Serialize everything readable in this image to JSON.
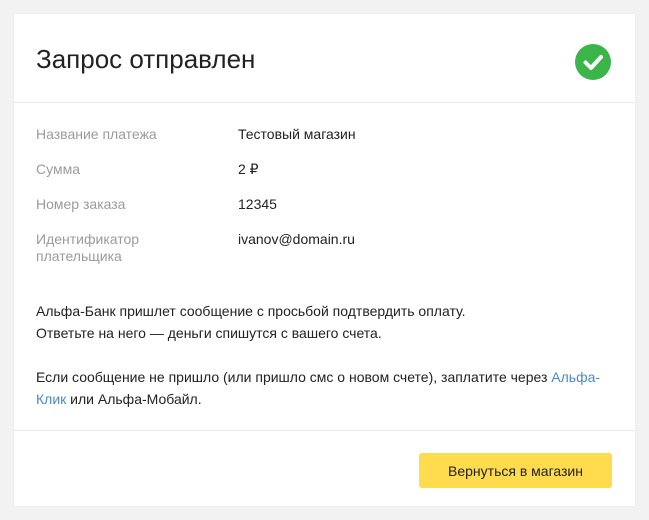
{
  "header": {
    "title": "Запрос отправлен",
    "status_icon": "check-circle-icon",
    "status_color": "#3bb54a"
  },
  "details": [
    {
      "label": "Название платежа",
      "value": "Тестовый магазин"
    },
    {
      "label": "Сумма",
      "value": "2 ₽"
    },
    {
      "label": "Номер заказа",
      "value": "12345"
    },
    {
      "label": "Идентификатор плательщика",
      "value": "ivanov@domain.ru"
    }
  ],
  "info": {
    "line1": "Альфа-Банк пришлет сообщение с просьбой подтвердить оплату.",
    "line2": "Ответьте на него — деньги спишутся с вашего счета.",
    "line3_prefix": "Если сообщение не пришло (или пришло смс о новом счете), заплатите через ",
    "line3_link": "Альфа-Клик",
    "line3_suffix": " или Альфа-Мобайл."
  },
  "footer": {
    "return_label": "Вернуться в магазин",
    "button_color": "#ffdb4d"
  },
  "colors": {
    "link": "#4a8ac9",
    "label": "#9b9b9b",
    "text": "#222222"
  }
}
